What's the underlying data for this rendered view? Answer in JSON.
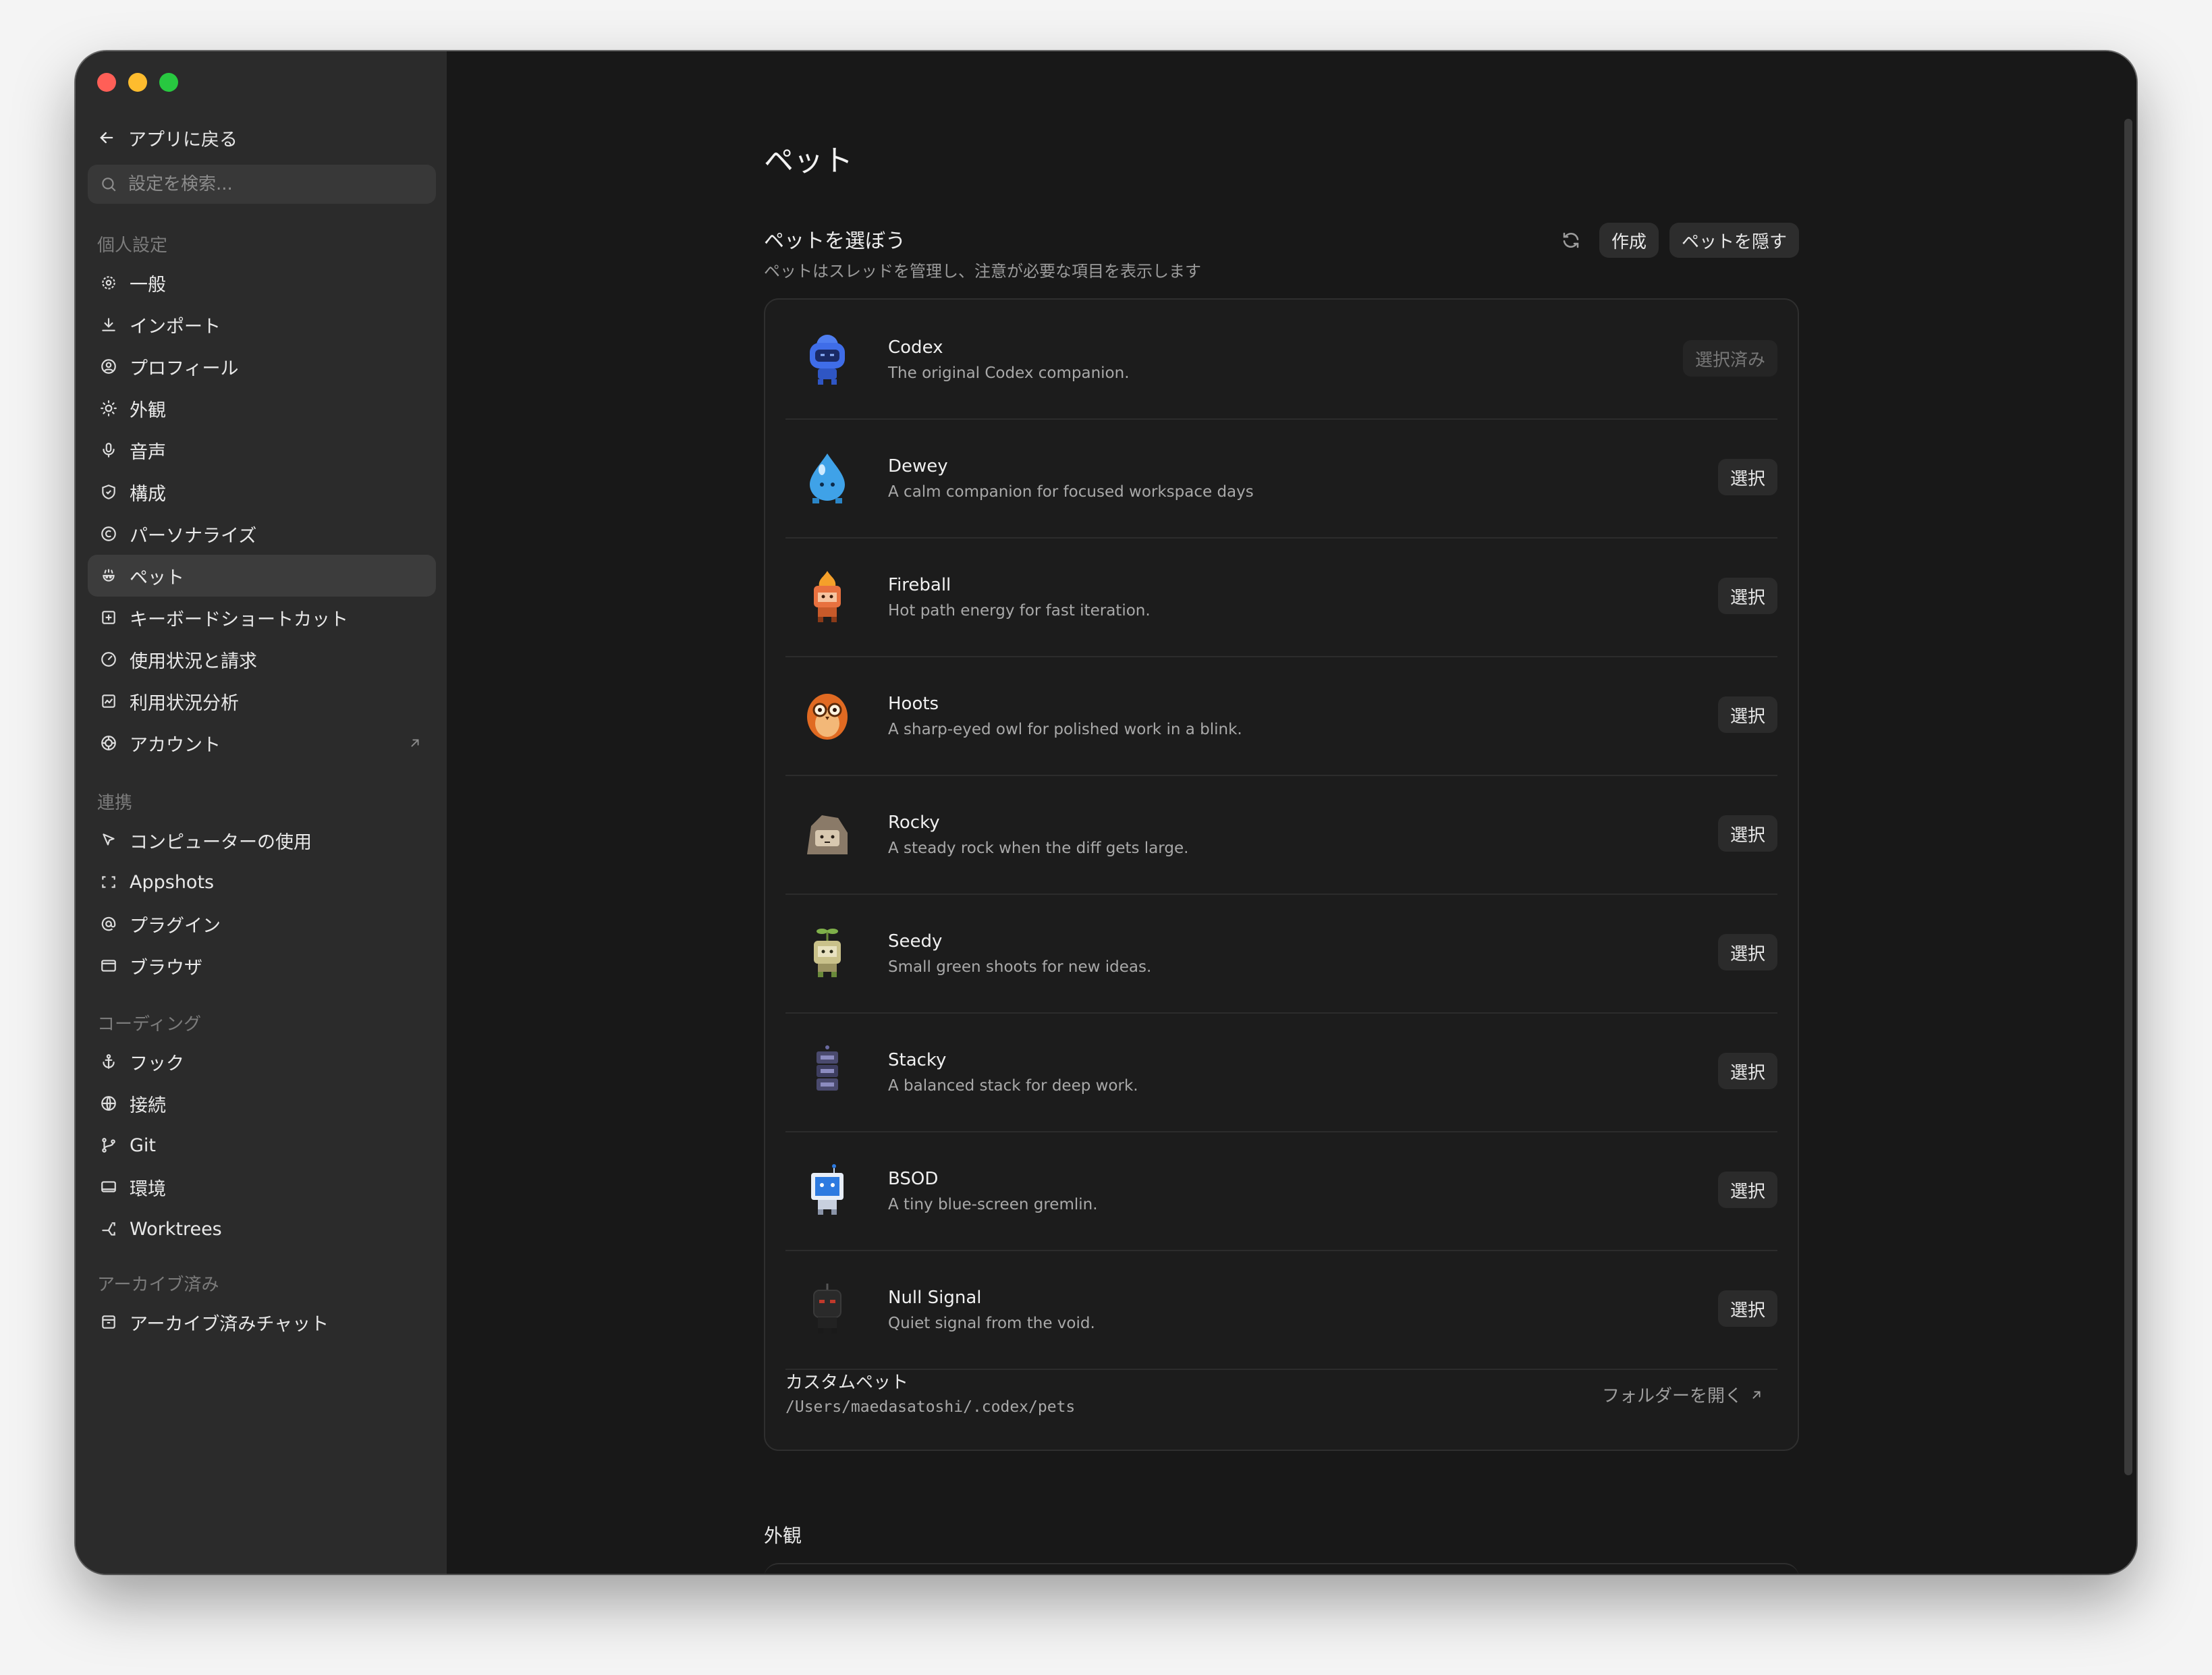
{
  "sidebar": {
    "back_label": "アプリに戻る",
    "search_placeholder": "設定を検索...",
    "sections": [
      {
        "label": "個人設定",
        "items": [
          {
            "label": "一般",
            "icon": "gear-icon"
          },
          {
            "label": "インポート",
            "icon": "download-icon"
          },
          {
            "label": "プロフィール",
            "icon": "profile-icon"
          },
          {
            "label": "外観",
            "icon": "sun-icon"
          },
          {
            "label": "音声",
            "icon": "mic-icon"
          },
          {
            "label": "構成",
            "icon": "shield-icon"
          },
          {
            "label": "パーソナライズ",
            "icon": "personalize-icon"
          },
          {
            "label": "ペット",
            "icon": "pet-icon",
            "active": true
          },
          {
            "label": "キーボードショートカット",
            "icon": "keyboard-icon"
          },
          {
            "label": "使用状況と請求",
            "icon": "gauge-icon"
          },
          {
            "label": "利用状況分析",
            "icon": "chart-icon"
          },
          {
            "label": "アカウント",
            "icon": "account-icon",
            "external": true
          }
        ]
      },
      {
        "label": "連携",
        "items": [
          {
            "label": "コンピューターの使用",
            "icon": "cursor-icon"
          },
          {
            "label": "Appshots",
            "icon": "frame-icon"
          },
          {
            "label": "プラグイン",
            "icon": "at-icon"
          },
          {
            "label": "ブラウザ",
            "icon": "browser-icon"
          }
        ]
      },
      {
        "label": "コーディング",
        "items": [
          {
            "label": "フック",
            "icon": "anchor-icon"
          },
          {
            "label": "接続",
            "icon": "globe-icon"
          },
          {
            "label": "Git",
            "icon": "git-icon"
          },
          {
            "label": "環境",
            "icon": "monitor-icon"
          },
          {
            "label": "Worktrees",
            "icon": "worktree-icon"
          }
        ]
      },
      {
        "label": "アーカイブ済み",
        "items": [
          {
            "label": "アーカイブ済みチャット",
            "icon": "archive-icon"
          }
        ]
      }
    ]
  },
  "main": {
    "page_title": "ペット",
    "section_title": "ペットを選ぼう",
    "section_subtitle": "ペットはスレッドを管理し、注意が必要な項目を表示します",
    "create_label": "作成",
    "hide_label": "ペットを隠す",
    "select_label": "選択",
    "selected_label": "選択済み",
    "pets": [
      {
        "name": "Codex",
        "desc": "The original Codex companion.",
        "selected": true,
        "color": "#3f6de8"
      },
      {
        "name": "Dewey",
        "desc": "A calm companion for focused workspace days",
        "color": "#3fa2e8"
      },
      {
        "name": "Fireball",
        "desc": "Hot path energy for fast iteration.",
        "color": "#e8713f"
      },
      {
        "name": "Hoots",
        "desc": "A sharp-eyed owl for polished work in a blink.",
        "color": "#e06a22"
      },
      {
        "name": "Rocky",
        "desc": "A steady rock when the diff gets large.",
        "color": "#8a7a68"
      },
      {
        "name": "Seedy",
        "desc": "Small green shoots for new ideas.",
        "color": "#c9c18a"
      },
      {
        "name": "Stacky",
        "desc": "A balanced stack for deep work.",
        "color": "#4a4a6e"
      },
      {
        "name": "BSOD",
        "desc": "A tiny blue-screen gremlin.",
        "color": "#2d7ae0"
      },
      {
        "name": "Null Signal",
        "desc": "Quiet signal from the void.",
        "color": "#2a2a2a"
      }
    ],
    "custom_title": "カスタムペット",
    "custom_path": "/Users/maedasatoshi/.codex/pets",
    "open_folder_label": "フォルダーを開く",
    "appearance_title": "外観"
  }
}
